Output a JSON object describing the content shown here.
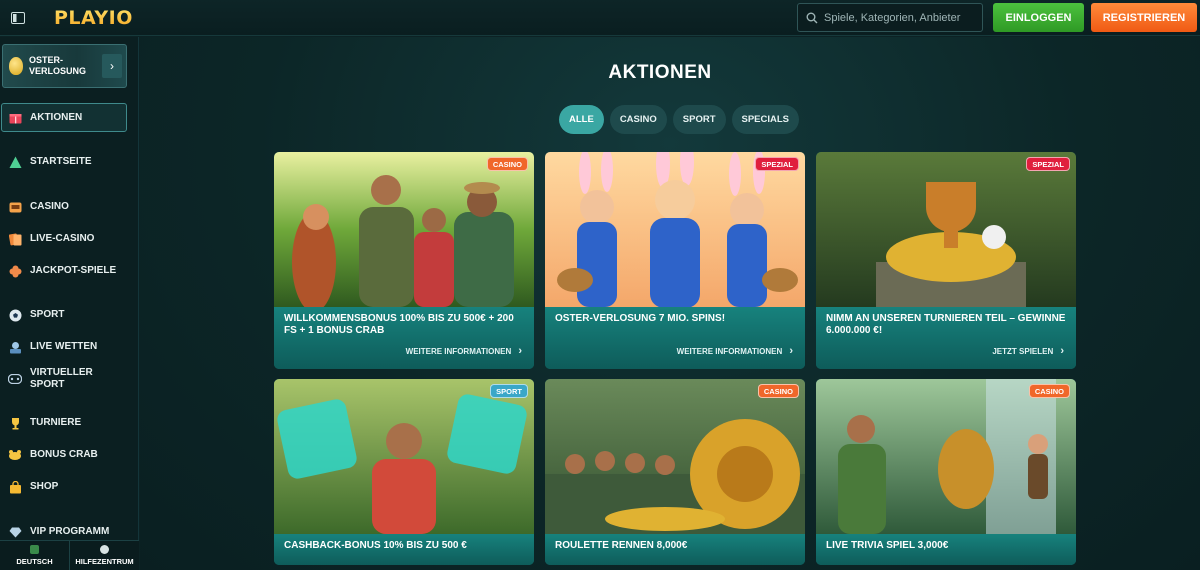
{
  "brand": {
    "logo_text": "PLAYIO"
  },
  "header": {
    "search_placeholder": "Spiele, Kategorien, Anbieter",
    "login_label": "EINLOGGEN",
    "register_label": "REGISTRIEREN"
  },
  "sidebar": {
    "promo_label": "OSTER-VERLOSUNG",
    "items": [
      {
        "label": "AKTIONEN",
        "icon": "gift-icon"
      },
      {
        "label": "STARTSEITE",
        "icon": "home-icon"
      },
      {
        "label": "CASINO",
        "icon": "slot-icon"
      },
      {
        "label": "LIVE-CASINO",
        "icon": "cards-icon"
      },
      {
        "label": "JACKPOT-SPIELE",
        "icon": "clover-icon"
      },
      {
        "label": "SPORT",
        "icon": "soccer-ball-icon"
      },
      {
        "label": "LIVE WETTEN",
        "icon": "live-icon"
      },
      {
        "label": "VIRTUELLER SPORT",
        "icon": "gamepad-icon"
      },
      {
        "label": "TURNIERE",
        "icon": "trophy-icon"
      },
      {
        "label": "BONUS CRAB",
        "icon": "crab-icon"
      },
      {
        "label": "SHOP",
        "icon": "shop-bag-icon"
      },
      {
        "label": "VIP PROGRAMM",
        "icon": "diamond-icon"
      }
    ],
    "bottom": {
      "language": "DEUTSCH",
      "help": "HILFEZENTRUM"
    }
  },
  "main": {
    "title": "AKTIONEN",
    "filters": [
      "ALLE",
      "CASINO",
      "SPORT",
      "SPECIALS"
    ],
    "active_filter": "ALLE",
    "cards": [
      {
        "badge": "CASINO",
        "title": "WILLKOMMENSBONUS 100% BIS ZU 500€ + 200 FS + 1 BONUS CRAB",
        "cta": "WEITERE INFORMATIONEN"
      },
      {
        "badge": "SPEZIAL",
        "title": "OSTER-VERLOSUNG 7 MIO. SPINS!",
        "cta": "WEITERE INFORMATIONEN"
      },
      {
        "badge": "SPEZIAL",
        "title": "NIMM AN UNSEREN TURNIEREN TEIL – GEWINNE 6.000.000 €!",
        "cta": "JETZT SPIELEN"
      },
      {
        "badge": "SPORT",
        "title": "CASHBACK-BONUS 10% BIS ZU 500 €",
        "cta": ""
      },
      {
        "badge": "CASINO",
        "title": "ROULETTE RENNEN 8,000€",
        "cta": ""
      },
      {
        "badge": "CASINO",
        "title": "LIVE TRIVIA SPIEL 3,000€",
        "cta": ""
      }
    ]
  },
  "colors": {
    "accent": "#3aa7a3",
    "login": "#3fae32",
    "register": "#f4731f"
  }
}
